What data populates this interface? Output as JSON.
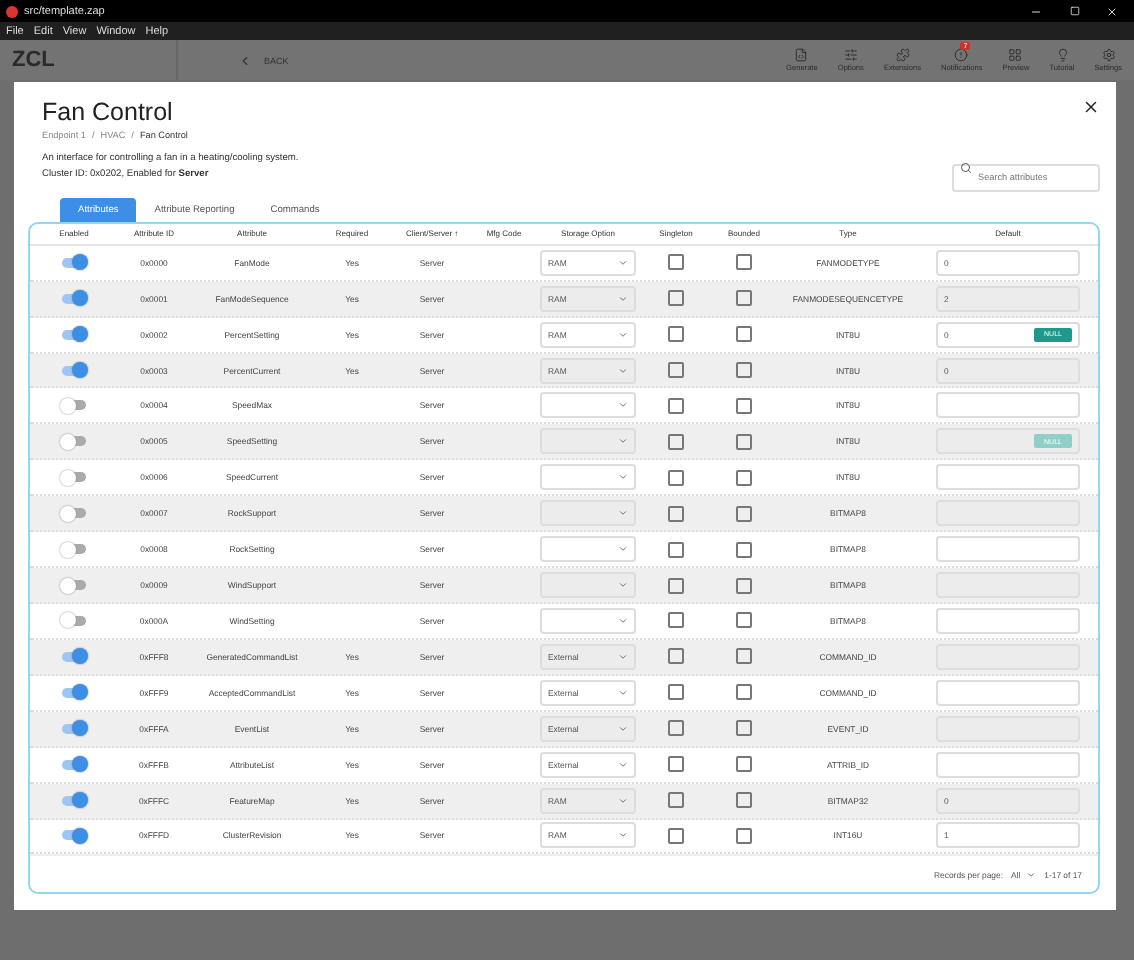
{
  "window": {
    "title": "src/template.zap"
  },
  "menu": [
    "File",
    "Edit",
    "View",
    "Window",
    "Help"
  ],
  "app_header": {
    "logo": "ZCL",
    "back": "BACK",
    "badge": "7",
    "toolbar": [
      {
        "label": "Generate",
        "kind": "generate"
      },
      {
        "label": "Options",
        "kind": "options"
      },
      {
        "label": "Extensions",
        "kind": "extensions"
      },
      {
        "label": "Notifications",
        "kind": "notifications"
      },
      {
        "label": "Preview",
        "kind": "preview"
      },
      {
        "label": "Tutorial",
        "kind": "tutorial"
      },
      {
        "label": "Settings",
        "kind": "settings"
      }
    ]
  },
  "dialog": {
    "title": "Fan Control",
    "breadcrumb": [
      "Endpoint 1",
      "HVAC",
      "Fan Control"
    ],
    "breadcrumb_separator": "/",
    "description": "An interface for controlling a fan in a heating/cooling system.",
    "cluster_info": "Cluster ID: 0x0202, Enabled for **Server**",
    "search": {
      "placeholder": "Search attributes"
    },
    "tabs": [
      {
        "label": "Attributes",
        "selected": true
      },
      {
        "label": "Attribute Reporting",
        "selected": false
      },
      {
        "label": "Commands",
        "selected": false
      }
    ],
    "table": {
      "columns": [
        {
          "label": "Enabled"
        },
        {
          "label": "Attribute ID"
        },
        {
          "label": "Attribute"
        },
        {
          "label": "Required"
        },
        {
          "label": "Client/Server",
          "sort_arrow": "↑"
        },
        {
          "label": "Mfg Code"
        },
        {
          "label": "Storage Option"
        },
        {
          "label": "Singleton"
        },
        {
          "label": "Bounded"
        },
        {
          "label": "Type"
        },
        {
          "label": "Default"
        }
      ],
      "rows": [
        {
          "enabled": true,
          "id": "0x0000",
          "attribute": "FanMode",
          "required": "Yes",
          "side": "Server",
          "storage": "RAM",
          "singleton": false,
          "bounded": false,
          "type": "FANMODETYPE",
          "default": "0"
        },
        {
          "enabled": true,
          "id": "0x0001",
          "attribute": "FanModeSequence",
          "required": "Yes",
          "side": "Server",
          "storage": "RAM",
          "singleton": false,
          "bounded": false,
          "type": "FANMODESEQUENCETYPE",
          "default": "2"
        },
        {
          "enabled": true,
          "id": "0x0002",
          "attribute": "PercentSetting",
          "required": "Yes",
          "side": "Server",
          "storage": "RAM",
          "singleton": false,
          "bounded": false,
          "type": "INT8U",
          "default": "0",
          "null_button": {
            "label": "NULL",
            "disabled": false
          }
        },
        {
          "enabled": true,
          "id": "0x0003",
          "attribute": "PercentCurrent",
          "required": "Yes",
          "side": "Server",
          "storage": "RAM",
          "singleton": false,
          "bounded": false,
          "type": "INT8U",
          "default": "0"
        },
        {
          "enabled": false,
          "id": "0x0004",
          "attribute": "SpeedMax",
          "side": "Server",
          "singleton": false,
          "bounded": false,
          "type": "INT8U"
        },
        {
          "enabled": false,
          "id": "0x0005",
          "attribute": "SpeedSetting",
          "side": "Server",
          "singleton": false,
          "bounded": false,
          "type": "INT8U",
          "null_button": {
            "label": "NULL",
            "disabled": true
          }
        },
        {
          "enabled": false,
          "id": "0x0006",
          "attribute": "SpeedCurrent",
          "side": "Server",
          "singleton": false,
          "bounded": false,
          "type": "INT8U"
        },
        {
          "enabled": false,
          "id": "0x0007",
          "attribute": "RockSupport",
          "side": "Server",
          "singleton": false,
          "bounded": false,
          "type": "BITMAP8"
        },
        {
          "enabled": false,
          "id": "0x0008",
          "attribute": "RockSetting",
          "side": "Server",
          "singleton": false,
          "bounded": false,
          "type": "BITMAP8"
        },
        {
          "enabled": false,
          "id": "0x0009",
          "attribute": "WindSupport",
          "side": "Server",
          "singleton": false,
          "bounded": false,
          "type": "BITMAP8"
        },
        {
          "enabled": false,
          "id": "0x000A",
          "attribute": "WindSetting",
          "side": "Server",
          "singleton": false,
          "bounded": false,
          "type": "BITMAP8"
        },
        {
          "enabled": true,
          "id": "0xFFF8",
          "attribute": "GeneratedCommandList",
          "required": "Yes",
          "side": "Server",
          "storage": "External",
          "singleton": false,
          "bounded": false,
          "type": "COMMAND_ID"
        },
        {
          "enabled": true,
          "id": "0xFFF9",
          "attribute": "AcceptedCommandList",
          "required": "Yes",
          "side": "Server",
          "storage": "External",
          "singleton": false,
          "bounded": false,
          "type": "COMMAND_ID"
        },
        {
          "enabled": true,
          "id": "0xFFFA",
          "attribute": "EventList",
          "required": "Yes",
          "side": "Server",
          "storage": "External",
          "singleton": false,
          "bounded": false,
          "type": "EVENT_ID"
        },
        {
          "enabled": true,
          "id": "0xFFFB",
          "attribute": "AttributeList",
          "required": "Yes",
          "side": "Server",
          "storage": "External",
          "singleton": false,
          "bounded": false,
          "type": "ATTRIB_ID"
        },
        {
          "enabled": true,
          "id": "0xFFFC",
          "attribute": "FeatureMap",
          "required": "Yes",
          "side": "Server",
          "storage": "RAM",
          "singleton": false,
          "bounded": false,
          "type": "BITMAP32",
          "default": "0"
        },
        {
          "enabled": true,
          "id": "0xFFFD",
          "attribute": "ClusterRevision",
          "required": "Yes",
          "side": "Server",
          "storage": "RAM",
          "singleton": false,
          "bounded": false,
          "type": "INT16U",
          "default": "1"
        }
      ]
    },
    "footer": {
      "label": "Records per page:",
      "per_page": "All",
      "range": "1-17 of 17"
    }
  }
}
